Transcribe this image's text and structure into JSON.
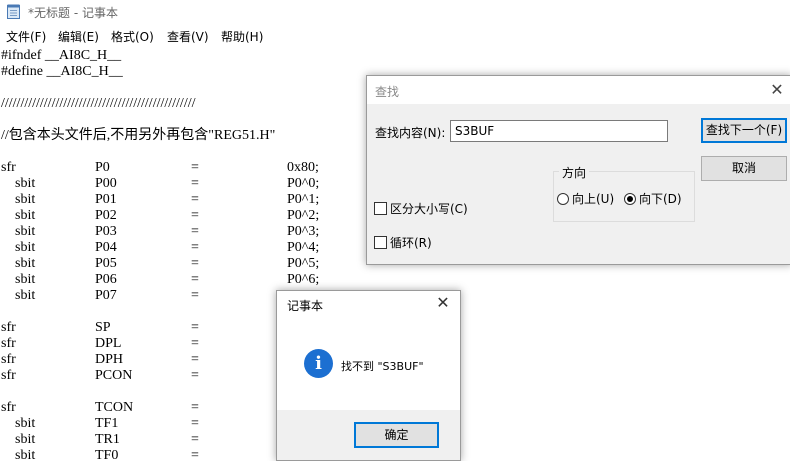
{
  "window": {
    "title": "*无标题 - 记事本",
    "icon": "notepad-icon"
  },
  "menu": [
    "文件(F)",
    "编辑(E)",
    "格式(O)",
    "查看(V)",
    "帮助(H)"
  ],
  "editor": {
    "lines": [
      [
        "#ifndef __AI8C_H__"
      ],
      [
        "#define __AI8C_H__"
      ],
      [
        ""
      ],
      [
        "//////////////////////////////////////////////////"
      ],
      [
        ""
      ],
      [
        "//包含本头文件后,不用另外再包含\"REG51.H\""
      ],
      [
        ""
      ],
      [
        "sfr",
        "P0",
        "=",
        "0x80;"
      ],
      [
        "    sbit",
        "P00",
        "=",
        "P0^0;"
      ],
      [
        "    sbit",
        "P01",
        "=",
        "P0^1;"
      ],
      [
        "    sbit",
        "P02",
        "=",
        "P0^2;"
      ],
      [
        "    sbit",
        "P03",
        "=",
        "P0^3;"
      ],
      [
        "    sbit",
        "P04",
        "=",
        "P0^4;"
      ],
      [
        "    sbit",
        "P05",
        "=",
        "P0^5;"
      ],
      [
        "    sbit",
        "P06",
        "=",
        "P0^6;"
      ],
      [
        "    sbit",
        "P07",
        "=",
        ""
      ],
      [
        ""
      ],
      [
        "sfr",
        "SP",
        "=",
        ""
      ],
      [
        "sfr",
        "DPL",
        "=",
        ""
      ],
      [
        "sfr",
        "DPH",
        "=",
        ""
      ],
      [
        "sfr",
        "PCON",
        "=",
        ""
      ],
      [
        ""
      ],
      [
        "sfr",
        "TCON",
        "=",
        ""
      ],
      [
        "    sbit",
        "TF1",
        "=",
        ""
      ],
      [
        "    sbit",
        "TR1",
        "=",
        ""
      ],
      [
        "    sbit",
        "TF0",
        "=",
        ""
      ]
    ]
  },
  "find_dialog": {
    "title": "查找",
    "find_label": "查找内容(N):",
    "find_value": "S3BUF",
    "find_next": "查找下一个(F)",
    "cancel": "取消",
    "direction_label": "方向",
    "up": "向上(U)",
    "down": "向下(D)",
    "direction_selected": "down",
    "match_case": "区分大小写(C)",
    "wrap": "循环(R)"
  },
  "message_box": {
    "title": "记事本",
    "message": "找不到 \"S3BUF\"",
    "ok": "确定",
    "icon": "info-icon"
  }
}
